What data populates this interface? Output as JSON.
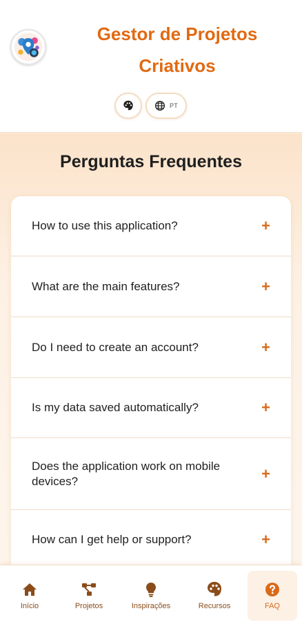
{
  "header": {
    "title_line1": "Gestor de Projetos",
    "title_line2": "Criativos",
    "language_code": "PT"
  },
  "colors": {
    "accent": "#e16a12",
    "nav_icon": "#8a4c1a",
    "active": "#d86a18"
  },
  "icons": {
    "logo": "logo-icon",
    "theme": "palette-icon",
    "language": "globe-icon"
  },
  "faq": {
    "title": "Perguntas Frequentes",
    "items": [
      {
        "question": "How to use this application?"
      },
      {
        "question": "What are the main features?"
      },
      {
        "question": "Do I need to create an account?"
      },
      {
        "question": "Is my data saved automatically?"
      },
      {
        "question": "Does the application work on mobile devices?"
      },
      {
        "question": "How can I get help or support?"
      }
    ],
    "expand_symbol": "+"
  },
  "nav": {
    "items": [
      {
        "label": "Início",
        "icon": "home-icon"
      },
      {
        "label": "Projetos",
        "icon": "project-diagram-icon"
      },
      {
        "label": "Inspirações",
        "icon": "lightbulb-icon"
      },
      {
        "label": "Recursos",
        "icon": "palette-icon"
      },
      {
        "label": "FAQ",
        "icon": "question-circle-icon"
      }
    ],
    "active": "FAQ"
  }
}
